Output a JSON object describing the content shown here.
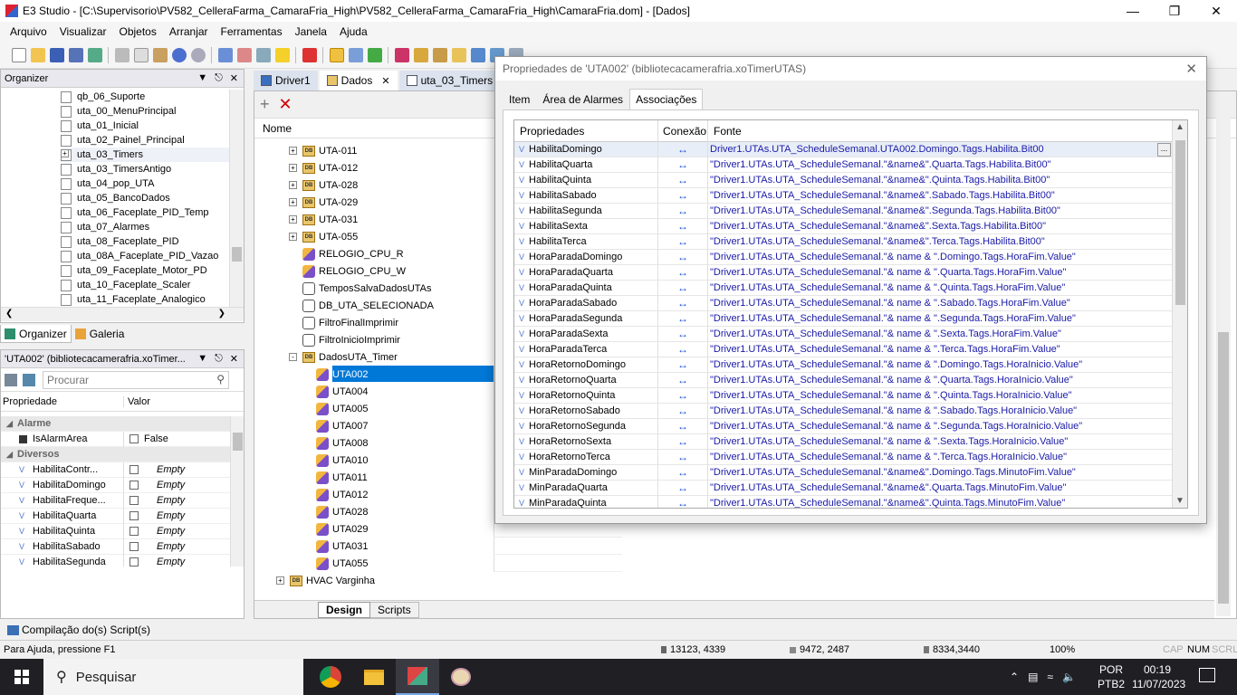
{
  "window": {
    "title": "E3 Studio - [C:\\Supervisorio\\PV582_CelleraFarma_CamaraFria_High\\PV582_CelleraFarma_CamaraFria_High\\CamaraFria.dom] - [Dados]"
  },
  "menu": [
    "Arquivo",
    "Visualizar",
    "Objetos",
    "Arranjar",
    "Ferramentas",
    "Janela",
    "Ajuda"
  ],
  "organizer": {
    "title": "Organizer",
    "items": [
      "qb_06_Suporte",
      "uta_00_MenuPrincipal",
      "uta_01_Inicial",
      "uta_02_Painel_Principal",
      "uta_03_Timers",
      "uta_03_TimersAntigo",
      "uta_04_pop_UTA",
      "uta_05_BancoDados",
      "uta_06_Faceplate_PID_Temp",
      "uta_07_Alarmes",
      "uta_08_Faceplate_PID",
      "uta_08A_Faceplate_PID_Vazao",
      "uta_09_Faceplate_Motor_PD",
      "uta_10_Faceplate_Scaler",
      "uta_11_Faceplate_Analogico"
    ],
    "tabs": [
      "Organizer",
      "Galeria"
    ]
  },
  "properties_panel": {
    "title": "'UTA002' (bibliotecacamerafria.xoTimer...",
    "search_placeholder": "Procurar",
    "col_prop": "Propriedade",
    "col_val": "Valor",
    "sections": [
      {
        "name": "Alarme",
        "rows": [
          {
            "name": "IsAlarmArea",
            "value": "False"
          }
        ]
      },
      {
        "name": "Diversos",
        "rows": [
          {
            "name": "HabilitaContr...",
            "value": "Empty"
          },
          {
            "name": "HabilitaDomingo",
            "value": "Empty"
          },
          {
            "name": "HabilitaFreque...",
            "value": "Empty"
          },
          {
            "name": "HabilitaQuarta",
            "value": "Empty"
          },
          {
            "name": "HabilitaQuinta",
            "value": "Empty"
          },
          {
            "name": "HabilitaSabado",
            "value": "Empty"
          },
          {
            "name": "HabilitaSegunda",
            "value": "Empty"
          }
        ]
      }
    ]
  },
  "doc_tabs": [
    "Driver1",
    "Dados",
    "uta_03_Timers"
  ],
  "data_tree": {
    "header": "Nome",
    "items": [
      {
        "label": "UTA-011",
        "level": 0,
        "type": "db",
        "expander": "+"
      },
      {
        "label": "UTA-012",
        "level": 0,
        "type": "db",
        "expander": "+"
      },
      {
        "label": "UTA-028",
        "level": 0,
        "type": "db",
        "expander": "+"
      },
      {
        "label": "UTA-029",
        "level": 0,
        "type": "db",
        "expander": "+"
      },
      {
        "label": "UTA-031",
        "level": 0,
        "type": "db",
        "expander": "+"
      },
      {
        "label": "UTA-055",
        "level": 0,
        "type": "db",
        "expander": "+"
      },
      {
        "label": "RELOGIO_CPU_R",
        "level": 0,
        "type": "obj",
        "expander": ""
      },
      {
        "label": "RELOGIO_CPU_W",
        "level": 0,
        "type": "obj",
        "expander": ""
      },
      {
        "label": "TemposSalvaDadosUTAs",
        "level": 0,
        "type": "var",
        "expander": ""
      },
      {
        "label": "DB_UTA_SELECIONADA",
        "level": 0,
        "type": "var",
        "expander": ""
      },
      {
        "label": "FiltroFinalImprimir",
        "level": 0,
        "type": "var",
        "expander": ""
      },
      {
        "label": "FiltroInicioImprimir",
        "level": 0,
        "type": "var",
        "expander": ""
      },
      {
        "label": "DadosUTA_Timer",
        "level": 0,
        "type": "db",
        "expander": "-"
      },
      {
        "label": "UTA002",
        "level": 1,
        "type": "obj",
        "expander": "",
        "selected": true
      },
      {
        "label": "UTA004",
        "level": 1,
        "type": "obj",
        "expander": ""
      },
      {
        "label": "UTA005",
        "level": 1,
        "type": "obj",
        "expander": ""
      },
      {
        "label": "UTA007",
        "level": 1,
        "type": "obj",
        "expander": ""
      },
      {
        "label": "UTA008",
        "level": 1,
        "type": "obj",
        "expander": ""
      },
      {
        "label": "UTA010",
        "level": 1,
        "type": "obj",
        "expander": ""
      },
      {
        "label": "UTA011",
        "level": 1,
        "type": "obj",
        "expander": ""
      },
      {
        "label": "UTA012",
        "level": 1,
        "type": "obj",
        "expander": ""
      },
      {
        "label": "UTA028",
        "level": 1,
        "type": "obj",
        "expander": ""
      },
      {
        "label": "UTA029",
        "level": 1,
        "type": "obj",
        "expander": ""
      },
      {
        "label": "UTA031",
        "level": 1,
        "type": "obj",
        "expander": ""
      },
      {
        "label": "UTA055",
        "level": 1,
        "type": "obj",
        "expander": ""
      },
      {
        "label": "HVAC Varginha",
        "level": -1,
        "type": "db",
        "expander": "+"
      }
    ],
    "bottom_tabs": [
      "Design",
      "Scripts"
    ]
  },
  "dialog": {
    "title": "Propriedades de 'UTA002' (bibliotecacamerafria.xoTimerUTAS)",
    "tabs": [
      "Item",
      "Área de Alarmes",
      "Associações"
    ],
    "columns": [
      "Propriedades",
      "Conexão",
      "Fonte"
    ],
    "rows": [
      {
        "prop": "HabilitaDomingo",
        "src": "Driver1.UTAs.UTA_ScheduleSemanal.UTA002.Domingo.Tags.Habilita.Bit00"
      },
      {
        "prop": "HabilitaQuarta",
        "src": "\"Driver1.UTAs.UTA_ScheduleSemanal.\"&name&\".Quarta.Tags.Habilita.Bit00\""
      },
      {
        "prop": "HabilitaQuinta",
        "src": "\"Driver1.UTAs.UTA_ScheduleSemanal.\"&name&\".Quinta.Tags.Habilita.Bit00\""
      },
      {
        "prop": "HabilitaSabado",
        "src": "\"Driver1.UTAs.UTA_ScheduleSemanal.\"&name&\".Sabado.Tags.Habilita.Bit00\""
      },
      {
        "prop": "HabilitaSegunda",
        "src": "\"Driver1.UTAs.UTA_ScheduleSemanal.\"&name&\".Segunda.Tags.Habilita.Bit00\""
      },
      {
        "prop": "HabilitaSexta",
        "src": "\"Driver1.UTAs.UTA_ScheduleSemanal.\"&name&\".Sexta.Tags.Habilita.Bit00\""
      },
      {
        "prop": "HabilitaTerca",
        "src": "\"Driver1.UTAs.UTA_ScheduleSemanal.\"&name&\".Terca.Tags.Habilita.Bit00\""
      },
      {
        "prop": "HoraParadaDomingo",
        "src": "\"Driver1.UTAs.UTA_ScheduleSemanal.\"& name & \".Domingo.Tags.HoraFim.Value\""
      },
      {
        "prop": "HoraParadaQuarta",
        "src": "\"Driver1.UTAs.UTA_ScheduleSemanal.\"& name & \".Quarta.Tags.HoraFim.Value\""
      },
      {
        "prop": "HoraParadaQuinta",
        "src": "\"Driver1.UTAs.UTA_ScheduleSemanal.\"& name & \".Quinta.Tags.HoraFim.Value\""
      },
      {
        "prop": "HoraParadaSabado",
        "src": "\"Driver1.UTAs.UTA_ScheduleSemanal.\"& name & \".Sabado.Tags.HoraFim.Value\""
      },
      {
        "prop": "HoraParadaSegunda",
        "src": "\"Driver1.UTAs.UTA_ScheduleSemanal.\"& name & \".Segunda.Tags.HoraFim.Value\""
      },
      {
        "prop": "HoraParadaSexta",
        "src": "\"Driver1.UTAs.UTA_ScheduleSemanal.\"& name & \".Sexta.Tags.HoraFim.Value\""
      },
      {
        "prop": "HoraParadaTerca",
        "src": "\"Driver1.UTAs.UTA_ScheduleSemanal.\"& name & \".Terca.Tags.HoraFim.Value\""
      },
      {
        "prop": "HoraRetornoDomingo",
        "src": "\"Driver1.UTAs.UTA_ScheduleSemanal.\"& name & \".Domingo.Tags.HoraInicio.Value\""
      },
      {
        "prop": "HoraRetornoQuarta",
        "src": "\"Driver1.UTAs.UTA_ScheduleSemanal.\"& name & \".Quarta.Tags.HoraInicio.Value\""
      },
      {
        "prop": "HoraRetornoQuinta",
        "src": "\"Driver1.UTAs.UTA_ScheduleSemanal.\"& name & \".Quinta.Tags.HoraInicio.Value\""
      },
      {
        "prop": "HoraRetornoSabado",
        "src": "\"Driver1.UTAs.UTA_ScheduleSemanal.\"& name & \".Sabado.Tags.HoraInicio.Value\""
      },
      {
        "prop": "HoraRetornoSegunda",
        "src": "\"Driver1.UTAs.UTA_ScheduleSemanal.\"& name & \".Segunda.Tags.HoraInicio.Value\""
      },
      {
        "prop": "HoraRetornoSexta",
        "src": "\"Driver1.UTAs.UTA_ScheduleSemanal.\"& name & \".Sexta.Tags.HoraInicio.Value\""
      },
      {
        "prop": "HoraRetornoTerca",
        "src": "\"Driver1.UTAs.UTA_ScheduleSemanal.\"& name & \".Terca.Tags.HoraInicio.Value\""
      },
      {
        "prop": "MinParadaDomingo",
        "src": "\"Driver1.UTAs.UTA_ScheduleSemanal.\"&name&\".Domingo.Tags.MinutoFim.Value\""
      },
      {
        "prop": "MinParadaQuarta",
        "src": "\"Driver1.UTAs.UTA_ScheduleSemanal.\"&name&\".Quarta.Tags.MinutoFim.Value\""
      },
      {
        "prop": "MinParadaQuinta",
        "src": "\"Driver1.UTAs.UTA_ScheduleSemanal.\"&name&\".Quinta.Tags.MinutoFim.Value\""
      }
    ],
    "connection_glyph": "↔",
    "ellipsis": "..."
  },
  "output_panel": {
    "label": "Compilação do(s) Script(s)"
  },
  "status": {
    "help": "Para Ajuda, pressione F1",
    "coord1": "13123, 4339",
    "coord2": "9472, 2487",
    "coord3": "8334,3440",
    "zoom": "100%",
    "caps": "CAP",
    "num": "NUM",
    "scrl": "SCRL"
  },
  "taskbar": {
    "search": "Pesquisar",
    "lang1": "POR",
    "lang2": "PTB2",
    "time": "00:19",
    "date": "11/07/2023"
  }
}
